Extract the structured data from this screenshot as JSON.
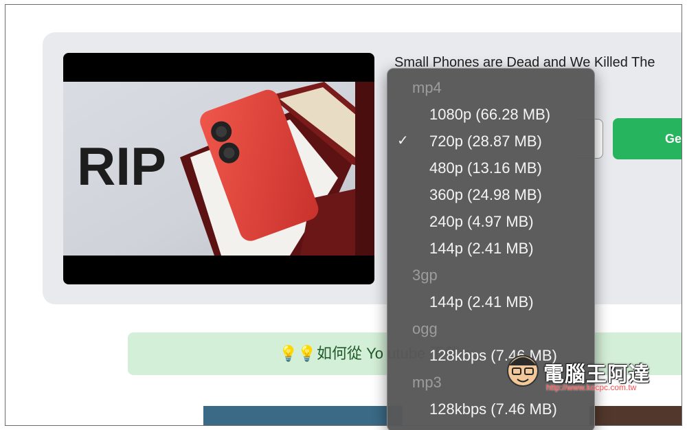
{
  "video": {
    "title": "Small Phones are Dead and We Killed The",
    "thumbnail_text": "RIP"
  },
  "get_button": {
    "label": "Ge"
  },
  "tip_banner": {
    "icons": "💡💡",
    "text": "如何從 Yo                    utube 下載 r"
  },
  "format_menu": {
    "groups": [
      {
        "label": "mp4",
        "items": [
          {
            "label": "1080p (66.28 MB)",
            "selected": false
          },
          {
            "label": "720p (28.87 MB)",
            "selected": true
          },
          {
            "label": "480p (13.16 MB)",
            "selected": false
          },
          {
            "label": "360p (24.98 MB)",
            "selected": false
          },
          {
            "label": "240p (4.97 MB)",
            "selected": false
          },
          {
            "label": "144p (2.41 MB)",
            "selected": false
          }
        ]
      },
      {
        "label": "3gp",
        "items": [
          {
            "label": "144p (2.41 MB)",
            "selected": false
          }
        ]
      },
      {
        "label": "ogg",
        "items": [
          {
            "label": "128kbps (7.46 MB)",
            "selected": false
          }
        ]
      },
      {
        "label": "mp3",
        "items": [
          {
            "label": "128kbps (7.46 MB)",
            "selected": false
          }
        ]
      }
    ],
    "checkmark": "✓"
  },
  "watermark": {
    "text": "電腦王阿達",
    "url": "http://www.kocpc.com.tw"
  },
  "colors": {
    "accent_green": "#27b45f",
    "banner_bg": "#d4efd7",
    "phone_red": "#e8473f",
    "menu_bg": "#585858"
  }
}
